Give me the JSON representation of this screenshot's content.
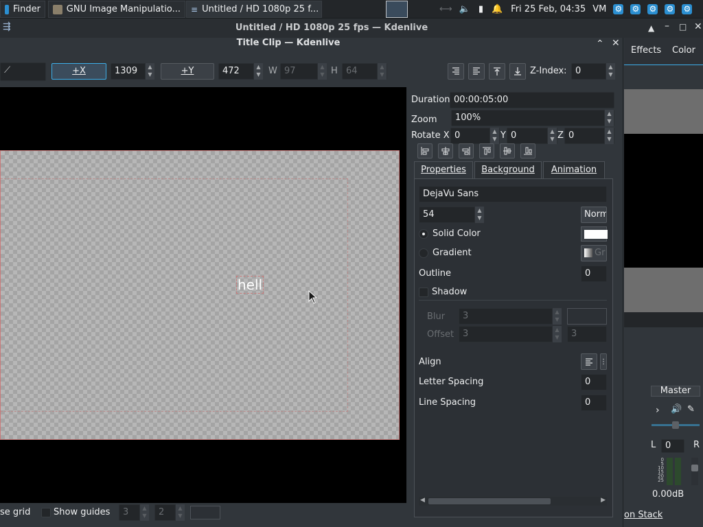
{
  "taskbar": {
    "items": [
      {
        "label": "Finder"
      },
      {
        "label": "GNU Image Manipulatio..."
      },
      {
        "label": "Untitled / HD 1080p 25 f..."
      }
    ],
    "clock": "Fri 25 Feb, 04:35",
    "vm": "VM"
  },
  "main_window": {
    "title": "Untitled / HD 1080p 25 fps — Kdenlive",
    "tabs": [
      "Effects",
      "Color"
    ],
    "master_label": "Master",
    "l_label": "L",
    "l_value": "0",
    "r_label": "R",
    "db_value": "0.00dB",
    "bottom_tab": "on Stack",
    "meter_ticks": [
      "0",
      "5",
      "10",
      "15",
      "20",
      "25",
      "30",
      "35",
      "40",
      "45"
    ]
  },
  "dialog": {
    "title": "Title Clip — Kdenlive",
    "toolbar": {
      "x_button": "+X",
      "x_value": "1309",
      "y_button": "+Y",
      "y_value": "472",
      "w_label": "W",
      "w_value": "97",
      "h_label": "H",
      "h_value": "64",
      "zindex_label": "Z-Index:",
      "zindex_value": "0"
    },
    "canvas": {
      "text": "hell"
    },
    "properties": {
      "duration_label": "Duration",
      "duration_value": "00:00:05:00",
      "zoom_label": "Zoom",
      "zoom_value": "100%",
      "rotate_x_label": "Rotate X",
      "rotate_x_value": "0",
      "rotate_y_label": "Y",
      "rotate_y_value": "0",
      "rotate_z_label": "Z",
      "rotate_z_value": "0",
      "tabs": [
        "Properties",
        "Background",
        "Animation"
      ],
      "font": "DejaVu Sans",
      "font_size": "54",
      "font_weight": "Norm",
      "solid_color_label": "Solid Color",
      "solid_color": "#ffffff",
      "gradient_label": "Gradient",
      "gradient_button": "Gr",
      "outline_label": "Outline",
      "outline_value": "0",
      "shadow_label": "Shadow",
      "blur_label": "Blur",
      "blur_value": "3",
      "offset_label": "Offset",
      "offset_value": "3",
      "offset_value2": "3",
      "align_label": "Align",
      "letter_spacing_label": "Letter Spacing",
      "letter_spacing_value": "0",
      "line_spacing_label": "Line Spacing",
      "line_spacing_value": "0"
    },
    "bottom": {
      "use_grid_label": "se grid",
      "show_guides_label": "Show guides",
      "guides_h": "3",
      "guides_v": "2"
    }
  },
  "colors": {
    "accent": "#3daee9",
    "window_bg": "#31363b",
    "taskbar_bg": "#232629"
  }
}
